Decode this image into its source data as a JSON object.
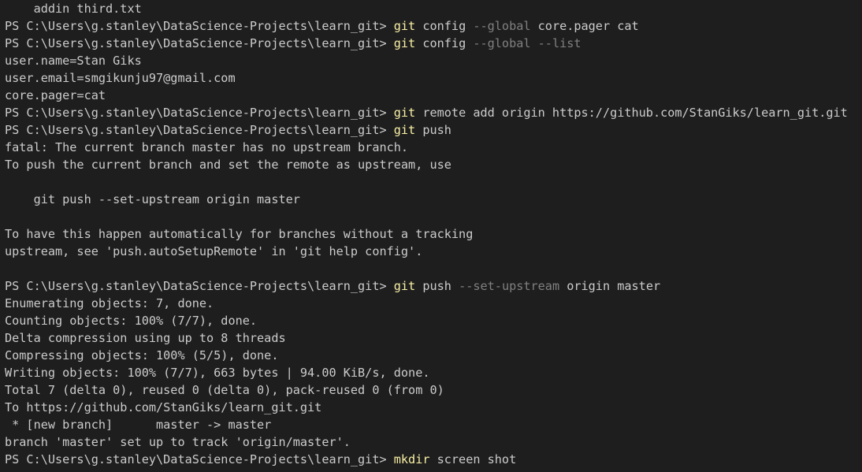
{
  "terminal": {
    "colors": {
      "background": "#1e1e1e",
      "text": "#cccccc",
      "command": "#f9f1a5",
      "flag": "#808080"
    },
    "lines": [
      {
        "type": "out",
        "text": "    addin third.txt"
      },
      {
        "type": "prompt",
        "prompt": "PS C:\\Users\\g.stanley\\DataScience-Projects\\learn_git> ",
        "command": "git",
        "parts": [
          {
            "t": " config ",
            "c": "arg"
          },
          {
            "t": "--global",
            "c": "flag"
          },
          {
            "t": " core.pager cat",
            "c": "arg"
          }
        ]
      },
      {
        "type": "prompt",
        "prompt": "PS C:\\Users\\g.stanley\\DataScience-Projects\\learn_git> ",
        "command": "git",
        "parts": [
          {
            "t": " config ",
            "c": "arg"
          },
          {
            "t": "--global --list",
            "c": "flag"
          }
        ]
      },
      {
        "type": "out",
        "text": "user.name=Stan Giks"
      },
      {
        "type": "out",
        "text": "user.email=smgikunju97@gmail.com"
      },
      {
        "type": "out",
        "text": "core.pager=cat"
      },
      {
        "type": "prompt",
        "prompt": "PS C:\\Users\\g.stanley\\DataScience-Projects\\learn_git> ",
        "command": "git",
        "parts": [
          {
            "t": " remote add origin https://github.com/StanGiks/learn_git.git",
            "c": "arg"
          }
        ]
      },
      {
        "type": "prompt",
        "prompt": "PS C:\\Users\\g.stanley\\DataScience-Projects\\learn_git> ",
        "command": "git",
        "parts": [
          {
            "t": " push",
            "c": "arg"
          }
        ]
      },
      {
        "type": "out",
        "text": "fatal: The current branch master has no upstream branch."
      },
      {
        "type": "out",
        "text": "To push the current branch and set the remote as upstream, use"
      },
      {
        "type": "out",
        "text": ""
      },
      {
        "type": "out",
        "text": "    git push --set-upstream origin master"
      },
      {
        "type": "out",
        "text": ""
      },
      {
        "type": "out",
        "text": "To have this happen automatically for branches without a tracking"
      },
      {
        "type": "out",
        "text": "upstream, see 'push.autoSetupRemote' in 'git help config'."
      },
      {
        "type": "out",
        "text": ""
      },
      {
        "type": "prompt",
        "prompt": "PS C:\\Users\\g.stanley\\DataScience-Projects\\learn_git> ",
        "command": "git",
        "parts": [
          {
            "t": " push ",
            "c": "arg"
          },
          {
            "t": "--set-upstream",
            "c": "flag"
          },
          {
            "t": " origin master",
            "c": "arg"
          }
        ]
      },
      {
        "type": "out",
        "text": "Enumerating objects: 7, done."
      },
      {
        "type": "out",
        "text": "Counting objects: 100% (7/7), done."
      },
      {
        "type": "out",
        "text": "Delta compression using up to 8 threads"
      },
      {
        "type": "out",
        "text": "Compressing objects: 100% (5/5), done."
      },
      {
        "type": "out",
        "text": "Writing objects: 100% (7/7), 663 bytes | 94.00 KiB/s, done."
      },
      {
        "type": "out",
        "text": "Total 7 (delta 0), reused 0 (delta 0), pack-reused 0 (from 0)"
      },
      {
        "type": "out",
        "text": "To https://github.com/StanGiks/learn_git.git"
      },
      {
        "type": "out",
        "text": " * [new branch]      master -> master"
      },
      {
        "type": "out",
        "text": "branch 'master' set up to track 'origin/master'."
      },
      {
        "type": "prompt",
        "prompt": "PS C:\\Users\\g.stanley\\DataScience-Projects\\learn_git> ",
        "command": "mkdir",
        "parts": [
          {
            "t": " screen shot",
            "c": "arg"
          }
        ]
      }
    ]
  }
}
